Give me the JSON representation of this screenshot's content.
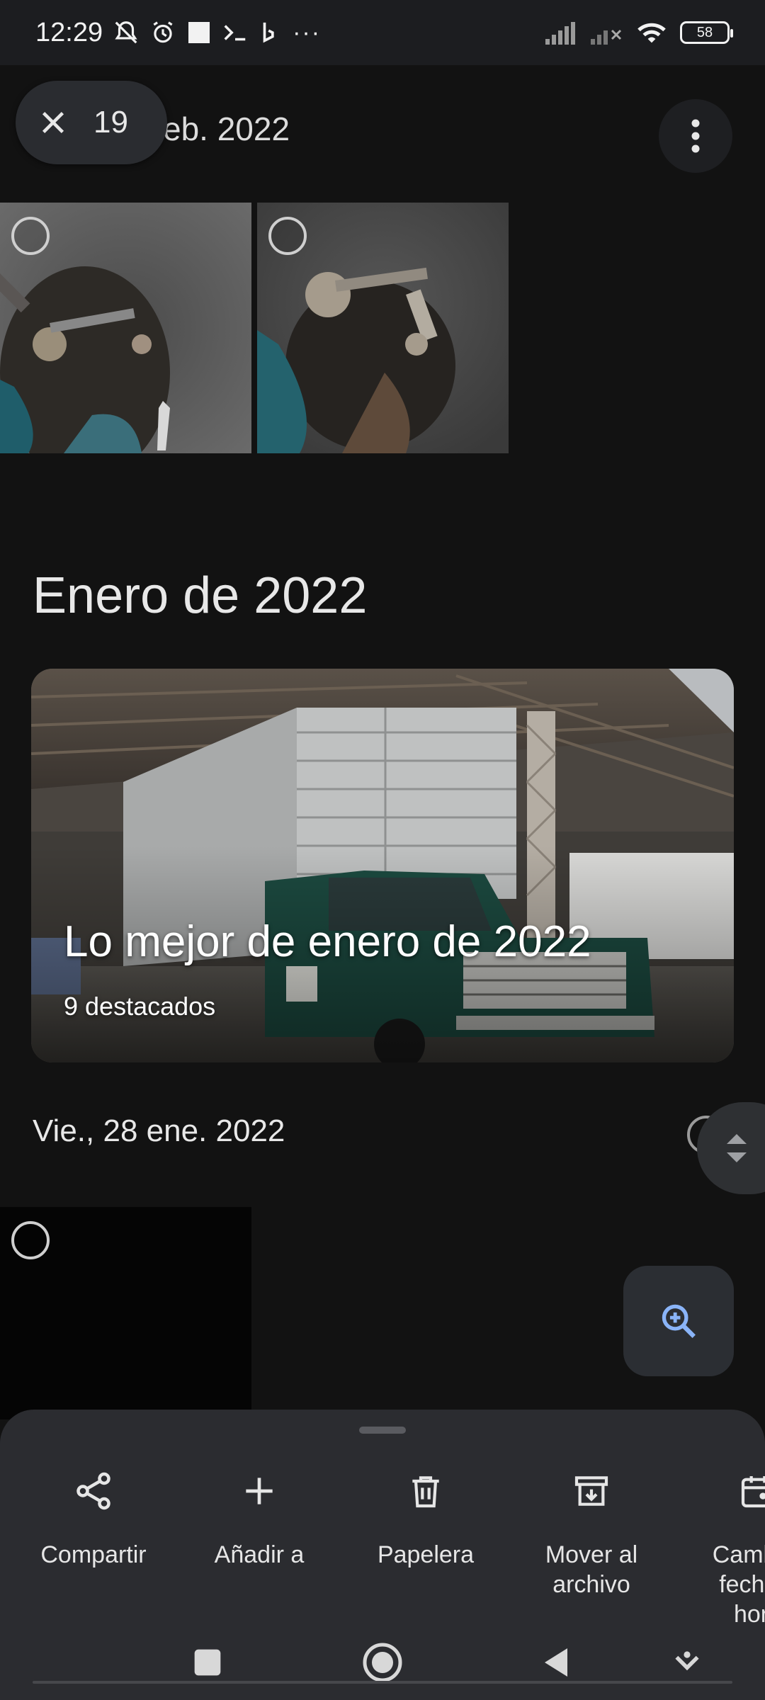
{
  "status_bar": {
    "time": "12:29",
    "battery": "58",
    "more": "···"
  },
  "top": {
    "selected_count": "19",
    "header_date": "eb. 2022"
  },
  "section": {
    "title": "Enero de 2022"
  },
  "highlight": {
    "title": "Lo mejor de enero de 2022",
    "subtitle": "9 destacados"
  },
  "day": {
    "label": "Vie., 28 ene. 2022"
  },
  "actions": [
    {
      "label": "Compartir",
      "icon": "share-icon"
    },
    {
      "label": "Añadir a",
      "icon": "plus-icon"
    },
    {
      "label": "Papelera",
      "icon": "trash-icon"
    },
    {
      "label": "Mover al archivo",
      "icon": "archive-icon"
    },
    {
      "label": "Cambiar fecha y hora",
      "icon": "calendar-icon"
    }
  ],
  "colors": {
    "background": "#121212",
    "sheet": "#2b2c30",
    "accent": "#8ab4f8"
  }
}
